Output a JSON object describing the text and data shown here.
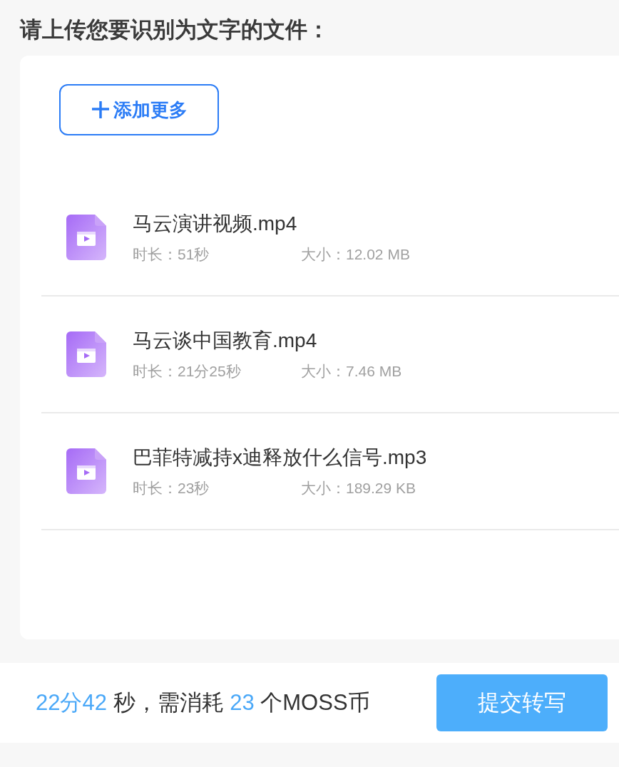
{
  "heading": "请上传您要识别为文字的文件：",
  "add_button": {
    "label": "添加更多"
  },
  "files": [
    {
      "name": "马云演讲视频.mp4",
      "duration": "时长：51秒",
      "size": "大小：12.02 MB"
    },
    {
      "name": "马云谈中国教育.mp4",
      "duration": "时长：21分25秒",
      "size": "大小：7.46 MB"
    },
    {
      "name": "巴菲特减持x迪释放什么信号.mp3",
      "duration": "时长：23秒",
      "size": "大小：189.29 KB"
    }
  ],
  "summary": [
    {
      "text": "22分42",
      "highlight": true
    },
    {
      "text": " 秒，需消耗 ",
      "highlight": false
    },
    {
      "text": "23",
      "highlight": true
    },
    {
      "text": " 个MOSS币",
      "highlight": false
    }
  ],
  "submit_button": {
    "label": "提交转写"
  }
}
